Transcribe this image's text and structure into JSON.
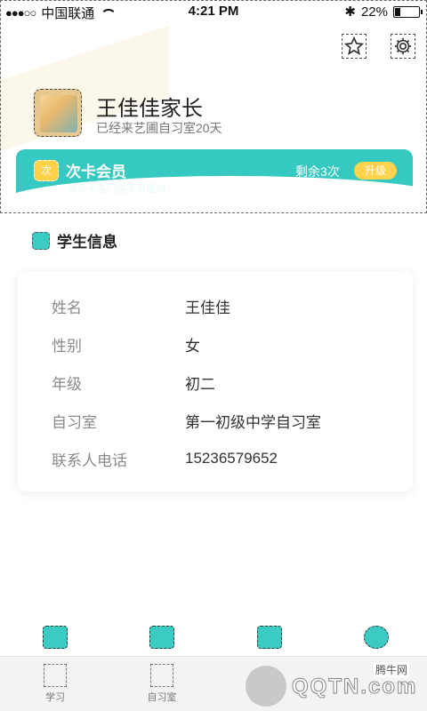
{
  "status": {
    "carrier": "中国联通",
    "time": "4:21 PM",
    "battery": "22%"
  },
  "header": {
    "parent_name": "王佳佳家长",
    "joined_text": "已经来艺圃自习室20天"
  },
  "membership": {
    "badge": "次",
    "title": "次卡会员",
    "note": "会员卡各门店不可通用",
    "remaining": "剩余3次",
    "upgrade": "升级"
  },
  "student": {
    "section_title": "学生信息",
    "rows": [
      {
        "label": "姓名",
        "value": "王佳佳"
      },
      {
        "label": "性别",
        "value": "女"
      },
      {
        "label": "年级",
        "value": "初二"
      },
      {
        "label": "自习室",
        "value": "第一初级中学自习室"
      },
      {
        "label": "联系人电话",
        "value": "15236579652"
      }
    ]
  },
  "tabs": [
    {
      "label": "学习"
    },
    {
      "label": "自习室"
    }
  ],
  "watermark": {
    "logo_text": "QQTN.com",
    "site": "腾牛网"
  },
  "colors": {
    "accent": "#35c9c1",
    "badge": "#ffd34d"
  },
  "icons": [
    "star-icon",
    "gear-icon",
    "book-icon",
    "home-icon",
    "compass-icon",
    "smile-icon"
  ]
}
